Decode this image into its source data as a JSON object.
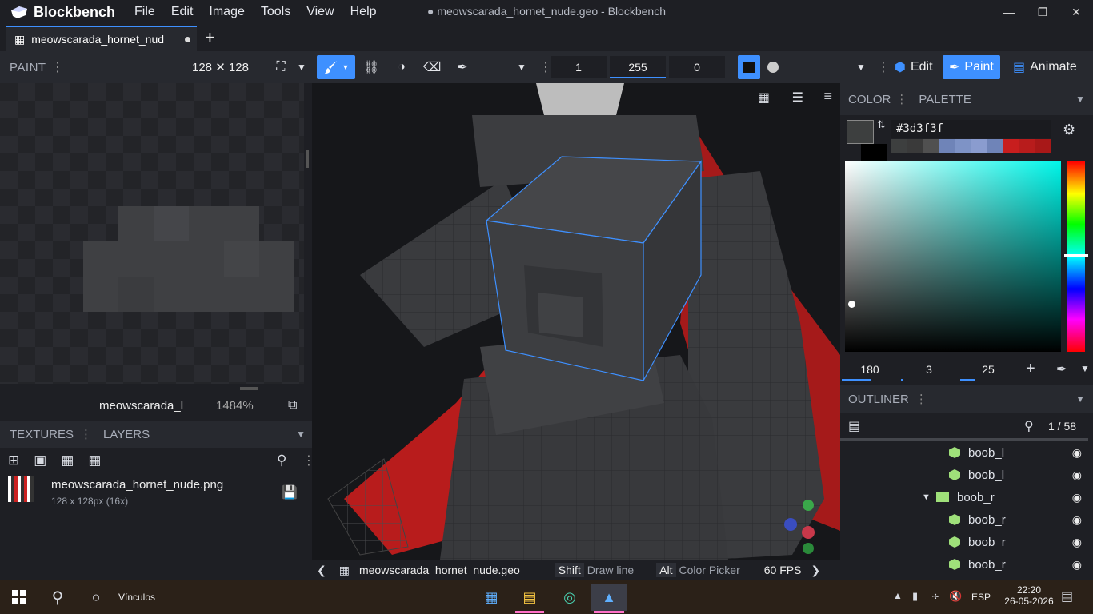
{
  "app": {
    "name": "Blockbench",
    "window_title": "● meowscarada_hornet_nude.geo - Blockbench"
  },
  "menu": [
    "File",
    "Edit",
    "Image",
    "Tools",
    "View",
    "Help"
  ],
  "tab": {
    "label": "meowscarada_hornet_nud"
  },
  "toolbar": {
    "panel_label": "PAINT",
    "size_label": "128 ✕ 128",
    "brush_size": "1",
    "opacity": "255",
    "softness": "0",
    "mode_edit": "Edit",
    "mode_paint": "Paint",
    "mode_animate": "Animate"
  },
  "uv": {
    "texture_name": "meowscarada_l",
    "zoom": "1484%"
  },
  "textures": {
    "tab_textures": "TEXTURES",
    "tab_layers": "LAYERS",
    "file_name": "meowscarada_hornet_nude.png",
    "file_meta": "128 x 128px (16x)"
  },
  "statusbar": {
    "file": "meowscarada_hornet_nude.geo",
    "shift_key": "Shift",
    "shift_action": "Draw line",
    "alt_key": "Alt",
    "alt_action": "Color Picker",
    "fps": "60 FPS"
  },
  "color": {
    "tab_color": "COLOR",
    "tab_palette": "PALETTE",
    "hex": "#3d3f3f",
    "h": "180",
    "s": "3",
    "v": "25",
    "primary": "#3d3f3f",
    "secondary": "#000000",
    "history": [
      "#3d3f3f",
      "#3a3a3a",
      "#505050",
      "#6f84b8",
      "#7e93c6",
      "#8a9ccf",
      "#6f84b8",
      "#c81e1e",
      "#b81c1c",
      "#a81818"
    ]
  },
  "outliner": {
    "label": "OUTLINER",
    "count": "1 / 58",
    "items": [
      {
        "name": "boob_l",
        "type": "cube"
      },
      {
        "name": "boob_l",
        "type": "cube"
      },
      {
        "name": "boob_r",
        "type": "group"
      },
      {
        "name": "boob_r",
        "type": "cube"
      },
      {
        "name": "boob_r",
        "type": "cube"
      },
      {
        "name": "boob_r",
        "type": "cube"
      }
    ]
  },
  "taskbar": {
    "search_label": "Vínculos",
    "lang": "ESP",
    "time": "22:20",
    "date": "26-05-2026"
  }
}
